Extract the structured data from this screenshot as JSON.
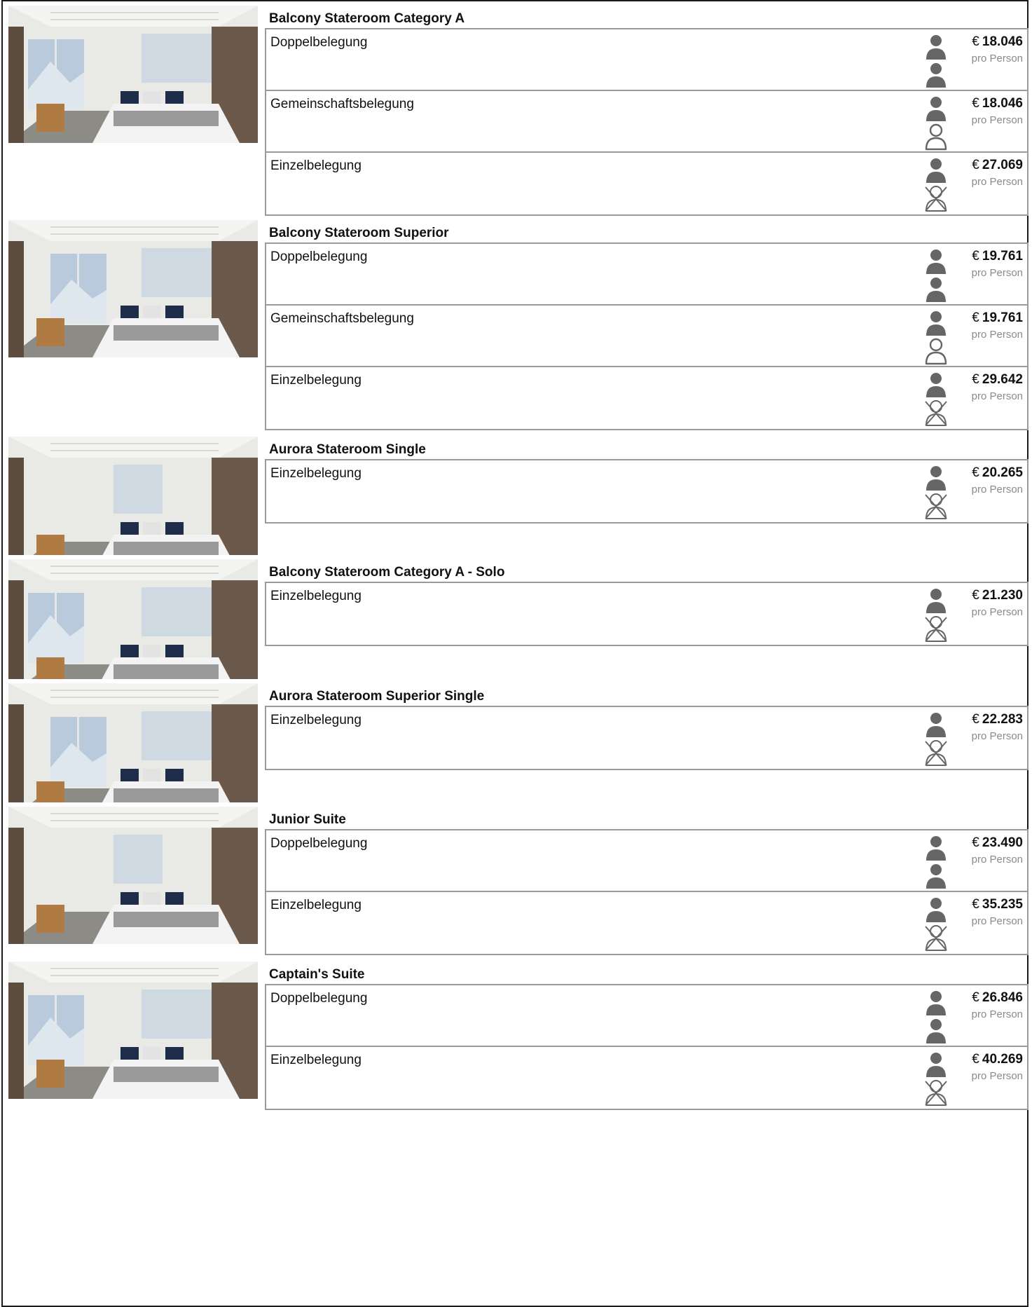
{
  "cabins": [
    {
      "title": "Balcony Stateroom Category A",
      "photo_icon": "cabin-photo-icon",
      "occupancies": [
        {
          "label": "Doppelbelegung",
          "icon": "two-persons",
          "currency": "€",
          "price": "18.046",
          "per": "pro Person"
        },
        {
          "label": "Gemeinschaftsbelegung",
          "icon": "shared",
          "currency": "€",
          "price": "18.046",
          "per": "pro Person"
        },
        {
          "label": "Einzelbelegung",
          "icon": "single",
          "currency": "€",
          "price": "27.069",
          "per": "pro Person"
        }
      ]
    },
    {
      "title": "Balcony Stateroom Superior",
      "photo_icon": "cabin-photo-icon",
      "occupancies": [
        {
          "label": "Doppelbelegung",
          "icon": "two-persons",
          "currency": "€",
          "price": "19.761",
          "per": "pro Person"
        },
        {
          "label": "Gemeinschaftsbelegung",
          "icon": "shared",
          "currency": "€",
          "price": "19.761",
          "per": "pro Person"
        },
        {
          "label": "Einzelbelegung",
          "icon": "single",
          "currency": "€",
          "price": "29.642",
          "per": "pro Person"
        }
      ]
    },
    {
      "title": "Aurora Stateroom Single",
      "photo_icon": "cabin-photo-icon",
      "occupancies": [
        {
          "label": "Einzelbelegung",
          "icon": "single",
          "currency": "€",
          "price": "20.265",
          "per": "pro Person"
        }
      ]
    },
    {
      "title": "Balcony Stateroom Category A - Solo",
      "photo_icon": "cabin-photo-icon",
      "occupancies": [
        {
          "label": "Einzelbelegung",
          "icon": "single",
          "currency": "€",
          "price": "21.230",
          "per": "pro Person"
        }
      ]
    },
    {
      "title": "Aurora Stateroom Superior Single",
      "photo_icon": "cabin-photo-icon",
      "occupancies": [
        {
          "label": "Einzelbelegung",
          "icon": "single",
          "currency": "€",
          "price": "22.283",
          "per": "pro Person"
        }
      ]
    },
    {
      "title": "Junior Suite",
      "photo_icon": "cabin-photo-icon",
      "occupancies": [
        {
          "label": "Doppelbelegung",
          "icon": "two-persons",
          "currency": "€",
          "price": "23.490",
          "per": "pro Person"
        },
        {
          "label": "Einzelbelegung",
          "icon": "single",
          "currency": "€",
          "price": "35.235",
          "per": "pro Person"
        }
      ]
    },
    {
      "title": "Captain's Suite",
      "photo_icon": "cabin-photo-icon",
      "occupancies": [
        {
          "label": "Doppelbelegung",
          "icon": "two-persons",
          "currency": "€",
          "price": "26.846",
          "per": "pro Person"
        },
        {
          "label": "Einzelbelegung",
          "icon": "single",
          "currency": "€",
          "price": "40.269",
          "per": "pro Person"
        }
      ]
    }
  ],
  "colors": {
    "border_dark": "#1a1a1a",
    "border_box": "#9a9a9a",
    "icon_fill": "#666666",
    "muted_text": "#8a8a8a"
  }
}
